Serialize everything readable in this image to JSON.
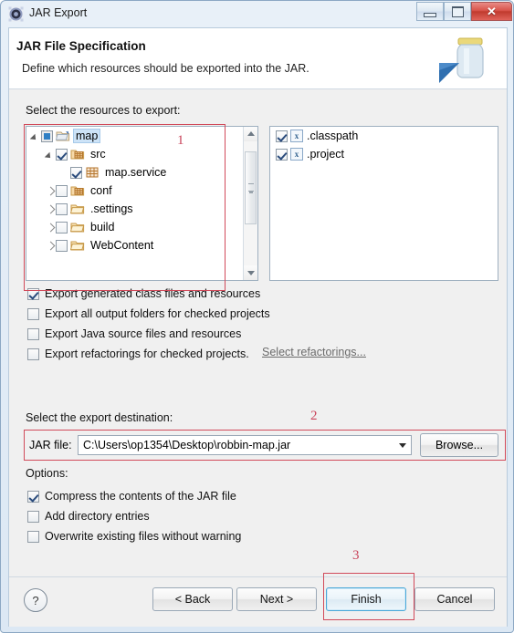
{
  "window": {
    "title": "JAR Export",
    "app_icon": "jar-export-icon",
    "controls": {
      "minimize": "minimize-button",
      "maximize": "maximize-button",
      "close_glyph": "✕"
    }
  },
  "header": {
    "title": "JAR File Specification",
    "subtitle": "Define which resources should be exported into the JAR.",
    "icon": "jar-banner-icon"
  },
  "resources": {
    "label": "Select the resources to export:",
    "tree": [
      {
        "label": "map",
        "indent": 0,
        "arrow": "expanded",
        "check": "grayed",
        "icon": "project-folder-icon",
        "selected": true
      },
      {
        "label": "src",
        "indent": 1,
        "arrow": "expanded",
        "check": "checked",
        "icon": "source-folder-icon",
        "selected": false
      },
      {
        "label": "map.service",
        "indent": 2,
        "arrow": "none",
        "check": "checked",
        "icon": "package-icon",
        "selected": false
      },
      {
        "label": "conf",
        "indent": 1,
        "arrow": "collapsed",
        "check": "unchecked",
        "icon": "source-folder-icon",
        "selected": false
      },
      {
        "label": ".settings",
        "indent": 1,
        "arrow": "collapsed",
        "check": "unchecked",
        "icon": "folder-icon",
        "selected": false
      },
      {
        "label": "build",
        "indent": 1,
        "arrow": "collapsed",
        "check": "unchecked",
        "icon": "folder-icon",
        "selected": false
      },
      {
        "label": "WebContent",
        "indent": 1,
        "arrow": "collapsed",
        "check": "unchecked",
        "icon": "folder-icon",
        "selected": false
      }
    ],
    "files": [
      {
        "label": ".classpath",
        "check": "checked",
        "icon": "xml-file-icon",
        "badge": "x"
      },
      {
        "label": ".project",
        "check": "checked",
        "icon": "xml-file-icon",
        "badge": "x"
      }
    ]
  },
  "export_options": [
    {
      "label": "Export generated class files and resources",
      "check": "checked"
    },
    {
      "label": "Export all output folders for checked projects",
      "check": "unchecked"
    },
    {
      "label": "Export Java source files and resources",
      "check": "unchecked"
    },
    {
      "label": "Export refactorings for checked projects.",
      "check": "unchecked"
    }
  ],
  "refactor_link": "Select refactorings...",
  "destination": {
    "label": "Select the export destination:",
    "jar_file_label": "JAR file:",
    "jar_file_value": "C:\\Users\\op1354\\Desktop\\robbin-map.jar",
    "browse_label": "Browse..."
  },
  "options": {
    "label": "Options:",
    "items": [
      {
        "label": "Compress the contents of the JAR file",
        "check": "checked"
      },
      {
        "label": "Add directory entries",
        "check": "unchecked"
      },
      {
        "label": "Overwrite existing files without warning",
        "check": "unchecked"
      }
    ]
  },
  "annotations": [
    {
      "number": "1"
    },
    {
      "number": "2"
    },
    {
      "number": "3"
    }
  ],
  "buttons": {
    "help": "?",
    "back": "< Back",
    "next": "Next >",
    "finish": "Finish",
    "cancel": "Cancel"
  },
  "colors": {
    "annotation_red": "#c9435a",
    "focus_blue": "#4aa8d8",
    "selection_blue": "#cde3f7",
    "close_red": "#c03a2e"
  }
}
